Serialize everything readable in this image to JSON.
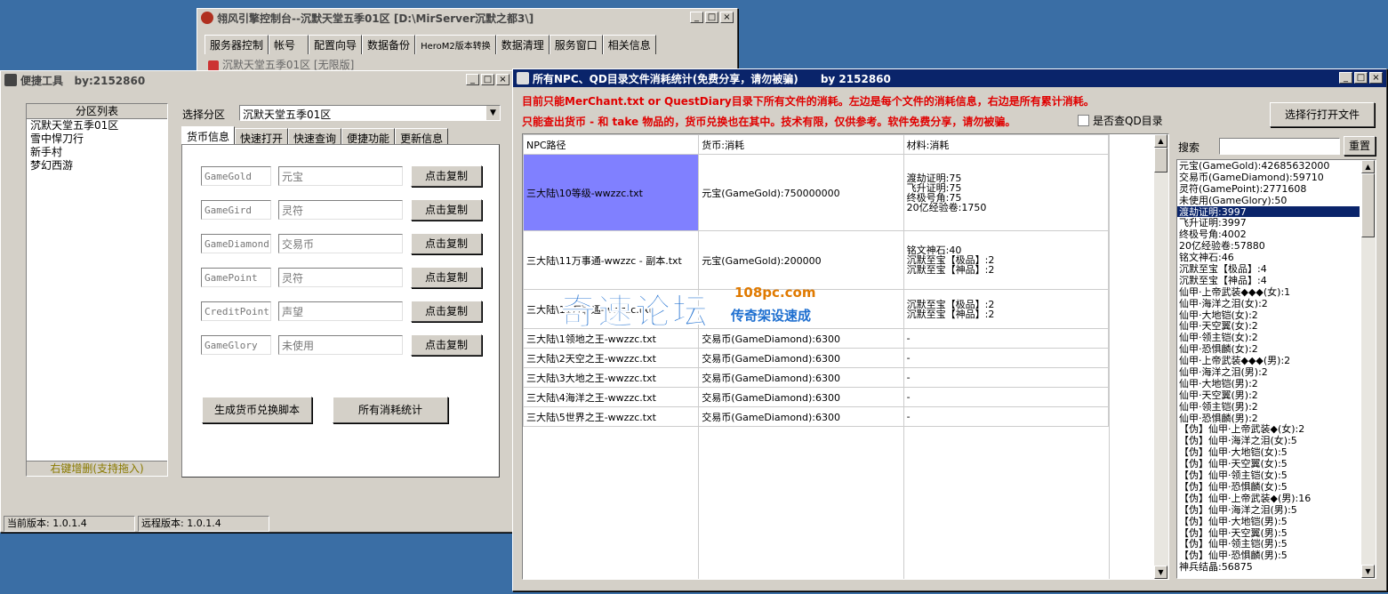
{
  "console": {
    "title": "翎风引擎控制台--沉默天堂五季01区 [D:\\MirServer沉默之都3\\]",
    "tabs": [
      "服务器控制",
      "帐号",
      "配置向导",
      "数据备份",
      "HeroM2版本转换",
      "数据清理",
      "服务窗口",
      "相关信息"
    ],
    "inner_title": "沉默天堂五季01区 [无限版]"
  },
  "tools": {
    "title": "便捷工具   by:2152860",
    "zone_list_header": "分区列表",
    "zones": [
      "沉默天堂五季01区",
      "雪中悍刀行",
      "新手村",
      "梦幻西游"
    ],
    "zone_list_footer": "右键增删(支持拖入)",
    "select_zone_label": "选择分区",
    "select_zone_value": "沉默天堂五季01区",
    "tabs": [
      "货币信息",
      "快速打开",
      "快速查询",
      "便捷功能",
      "更新信息"
    ],
    "currency_rows": [
      {
        "key": "GameGold",
        "name": "元宝",
        "button": "点击复制"
      },
      {
        "key": "GameGird",
        "name": "灵符",
        "button": "点击复制"
      },
      {
        "key": "GameDiamond",
        "name": "交易币",
        "button": "点击复制"
      },
      {
        "key": "GamePoint",
        "name": "灵符",
        "button": "点击复制"
      },
      {
        "key": "CreditPoint",
        "name": "声望",
        "button": "点击复制"
      },
      {
        "key": "GameGlory",
        "name": "未使用",
        "button": "点击复制"
      }
    ],
    "gen_button": "生成货币兑换脚本",
    "stats_button": "所有消耗统计",
    "current_version": "当前版本: 1.0.1.4",
    "remote_version": "远程版本: 1.0.1.4"
  },
  "stats": {
    "title": "所有NPC、QD目录文件消耗统计(免费分享，请勿被骗)      by 2152860",
    "notice1": "目前只能MerChant.txt or QuestDiary目录下所有文件的消耗。左边是每个文件的消耗信息，右边是所有累计消耗。",
    "notice2": "只能查出货币 - 和 take 物品的，货币兑换也在其中。技术有限，仅供参考。软件免费分享，请勿被骗。",
    "qd_checkbox": "是否查QD目录",
    "open_file_button": "选择行打开文件",
    "search_label": "搜索",
    "reset_button": "重置",
    "columns": [
      "NPC路径",
      "货币:消耗",
      "材料:消耗"
    ],
    "rows": [
      {
        "path": "三大陆\\10等级-wwzzc.txt",
        "currency": "元宝(GameGold):750000000",
        "materials": [
          "渡劫证明:75",
          "飞升证明:75",
          "终极号角:75",
          "20亿经验卷:1750"
        ],
        "selected": true
      },
      {
        "path": "三大陆\\11万事通-wwzzc - 副本.txt",
        "currency": "元宝(GameGold):200000",
        "materials": [
          "铭文神石:40",
          "沉默至宝【极品】:2",
          "沉默至宝【神品】:2"
        ]
      },
      {
        "path": "三大陆\\11万事通-wwzzc.txt",
        "currency": "",
        "materials": [
          "沉默至宝【极品】:2",
          "沉默至宝【神品】:2"
        ]
      },
      {
        "path": "三大陆\\1领地之王-wwzzc.txt",
        "currency": "交易币(GameDiamond):6300",
        "materials": [
          "-"
        ]
      },
      {
        "path": "三大陆\\2天空之王-wwzzc.txt",
        "currency": "交易币(GameDiamond):6300",
        "materials": [
          "-"
        ]
      },
      {
        "path": "三大陆\\3大地之王-wwzzc.txt",
        "currency": "交易币(GameDiamond):6300",
        "materials": [
          "-"
        ]
      },
      {
        "path": "三大陆\\4海洋之王-wwzzc.txt",
        "currency": "交易币(GameDiamond):6300",
        "materials": [
          "-"
        ]
      },
      {
        "path": "三大陆\\5世界之王-wwzzc.txt",
        "currency": "交易币(GameDiamond):6300",
        "materials": [
          "-"
        ]
      }
    ],
    "totals": [
      "元宝(GameGold):42685632000",
      "交易币(GameDiamond):59710",
      "灵符(GamePoint):2771608",
      "未使用(GameGlory):50",
      "渡劫证明:3997",
      "飞升证明:3997",
      "终极号角:4002",
      "20亿经验卷:57880",
      "铭文神石:46",
      "沉默至宝【极品】:4",
      "沉默至宝【神品】:4",
      "仙甲·上帝武装◆◆◆(女):1",
      "仙甲·海洋之泪(女):2",
      "仙甲·大地铠(女):2",
      "仙甲·天空翼(女):2",
      "仙甲·领主铠(女):2",
      "仙甲·恐惧麟(女):2",
      "仙甲·上帝武装◆◆◆(男):2",
      "仙甲·海洋之泪(男):2",
      "仙甲·大地铠(男):2",
      "仙甲·天空翼(男):2",
      "仙甲·领主铠(男):2",
      "仙甲·恐惧麟(男):2",
      "【伪】仙甲·上帝武装◆(女):2",
      "【伪】仙甲·海洋之泪(女):5",
      "【伪】仙甲·大地铠(女):5",
      "【伪】仙甲·天空翼(女):5",
      "【伪】仙甲·领主铠(女):5",
      "【伪】仙甲·恐惧麟(女):5",
      "【伪】仙甲·上帝武装◆(男):16",
      "【伪】仙甲·海洋之泪(男):5",
      "【伪】仙甲·大地铠(男):5",
      "【伪】仙甲·天空翼(男):5",
      "【伪】仙甲·领主铠(男):5",
      "【伪】仙甲·恐惧麟(男):5",
      "神兵结晶:56875"
    ],
    "totals_selected_index": 4
  },
  "watermark": {
    "main": "奇速论坛",
    "domain": "108pc.com",
    "sub": "传奇架设速成"
  },
  "colors": {
    "desktop": "#3a6ea5",
    "title_active": "#0a246a",
    "selected_cell": "#8080ff",
    "notice_red": "#e00000"
  }
}
